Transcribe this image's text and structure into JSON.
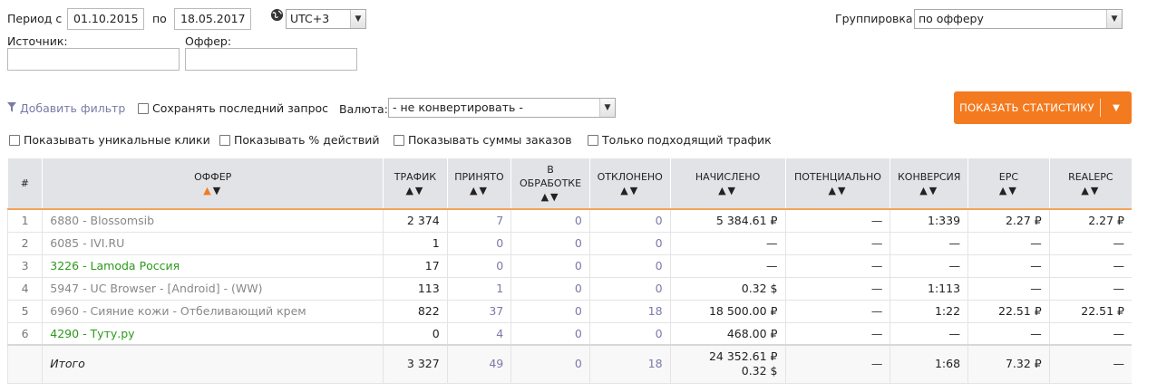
{
  "filters": {
    "period_label": "Период с",
    "date_from": "01.10.2015",
    "to_label": "по",
    "date_to": "18.05.2017",
    "timezone": "UTC+3",
    "grouping_label": "Группировка:",
    "grouping_value": "по офферу",
    "source_label": "Источник:",
    "offer_label": "Оффер:",
    "add_filter": "Добавить фильтр",
    "save_last_query": "Сохранять последний запрос",
    "currency_label": "Валюта:",
    "currency_value": "- не конвертировать -",
    "show_stats_button": "ПОКАЗАТЬ СТАТИСТИКУ",
    "show_unique_clicks": "Показывать уникальные клики",
    "show_actions_pct": "Показывать % действий",
    "show_order_sums": "Показывать суммы заказов",
    "only_matching_traffic": "Только подходящий трафик"
  },
  "icons": {
    "globe": "globe-icon",
    "filter": "filter-icon",
    "dropdown": "chevron-down-icon"
  },
  "colors": {
    "accent": "#f47a1f",
    "green_offer": "#2a9a18",
    "link": "#7a7aa8",
    "header_bg": "#e2e3e7"
  },
  "table": {
    "columns": [
      "#",
      "ОФФЕР",
      "ТРАФИК",
      "ПРИНЯТО",
      "В ОБРАБОТКЕ",
      "ОТКЛОНЕНО",
      "НАЧИСЛЕНО",
      "ПОТЕНЦИАЛЬНО",
      "КОНВЕРСИЯ",
      "EPC",
      "REALEPC"
    ],
    "sort_arrows": "▲▼",
    "rows": [
      {
        "num": "1",
        "offer": "6880 - Blossomsib",
        "green": false,
        "traffic": "2 374",
        "accepted": "7",
        "processing": "0",
        "rejected": "0",
        "accrued": "5 384.61 ₽",
        "potential": "—",
        "conversion": "1:339",
        "epc": "2.27 ₽",
        "realepc": "2.27 ₽"
      },
      {
        "num": "2",
        "offer": "6085 - IVI.RU",
        "green": false,
        "traffic": "1",
        "accepted": "0",
        "processing": "0",
        "rejected": "0",
        "accrued": "—",
        "potential": "—",
        "conversion": "—",
        "epc": "—",
        "realepc": "—"
      },
      {
        "num": "3",
        "offer": "3226 - Lamoda Россия",
        "green": true,
        "traffic": "17",
        "accepted": "0",
        "processing": "0",
        "rejected": "0",
        "accrued": "—",
        "potential": "—",
        "conversion": "—",
        "epc": "—",
        "realepc": "—"
      },
      {
        "num": "4",
        "offer": "5947 - UC Browser - [Android] - (WW)",
        "green": false,
        "traffic": "113",
        "accepted": "1",
        "processing": "0",
        "rejected": "0",
        "accrued": "0.32 $",
        "potential": "—",
        "conversion": "1:113",
        "epc": "—",
        "realepc": "—"
      },
      {
        "num": "5",
        "offer": "6960 - Сияние кожи - Отбеливающий крем",
        "green": false,
        "traffic": "822",
        "accepted": "37",
        "processing": "0",
        "rejected": "18",
        "accrued": "18 500.00 ₽",
        "potential": "—",
        "conversion": "1:22",
        "epc": "22.51 ₽",
        "realepc": "22.51 ₽"
      },
      {
        "num": "6",
        "offer": "4290 - Туту.ру",
        "green": true,
        "traffic": "0",
        "accepted": "4",
        "processing": "0",
        "rejected": "0",
        "accrued": "468.00 ₽",
        "potential": "—",
        "conversion": "—",
        "epc": "—",
        "realepc": "—"
      }
    ],
    "total": {
      "label": "Итого",
      "traffic": "3 327",
      "accepted": "49",
      "processing": "0",
      "rejected": "18",
      "accrued_rub": "24 352.61 ₽",
      "accrued_usd": "0.32 $",
      "potential": "—",
      "conversion": "1:68",
      "epc": "7.32 ₽",
      "realepc": "—"
    }
  }
}
